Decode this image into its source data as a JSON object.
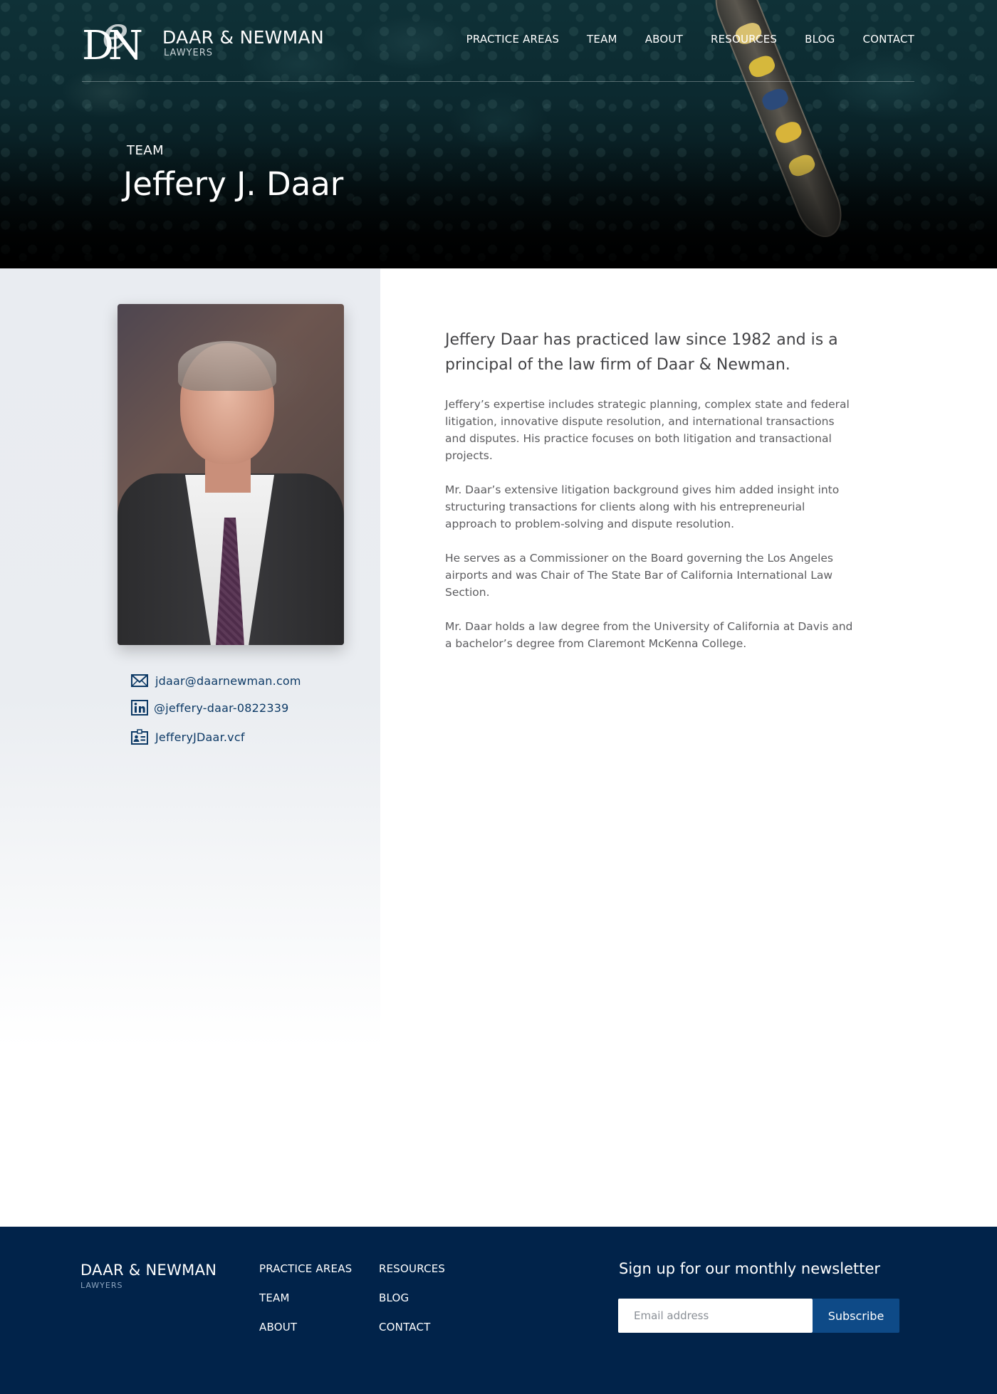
{
  "brand": {
    "name": "DAAR & NEWMAN",
    "sub": "LAWYERS",
    "mark_left": "DN",
    "mark_swash": "e"
  },
  "nav": [
    "PRACTICE AREAS",
    "TEAM",
    "ABOUT",
    "RESOURCES",
    "BLOG",
    "CONTACT"
  ],
  "hero": {
    "label": "TEAM",
    "title": "Jeffery J. Daar"
  },
  "contact": {
    "email": "jdaar@daarnewman.com",
    "linkedin": "@jeffery-daar-0822339",
    "vcard": "JefferyJDaar.vcf"
  },
  "bio": {
    "lead": "Jeffery Daar has practiced law since 1982 and is a principal of the law firm of Daar & Newman.",
    "paragraphs": [
      "Jeffery’s expertise includes strategic planning, complex state and federal litigation, innovative dispute resolution, and international transactions and disputes. His practice focuses on both litigation and transactional projects.",
      "Mr. Daar’s extensive litigation background gives him added insight into structuring transactions for clients along with his entrepreneurial approach to problem-solving and dispute resolution.",
      "He serves as a Commissioner on the Board governing the Los Angeles airports and was Chair of The State Bar of California International Law Section.",
      "Mr. Daar holds a law degree from the University of California at Davis and a bachelor’s degree from Claremont McKenna College."
    ]
  },
  "footer": {
    "brand": "DAAR & NEWMAN",
    "sub": "LAWYERS",
    "links_col1": [
      "PRACTICE AREAS",
      "TEAM",
      "ABOUT"
    ],
    "links_col2": [
      "RESOURCES",
      "BLOG",
      "CONTACT"
    ],
    "newsletter_title": "Sign up for our monthly newsletter",
    "email_placeholder": "Email address",
    "subscribe_label": "Subscribe"
  },
  "colors": {
    "footer_bg": "#01234a",
    "link": "#0d3a66",
    "button": "#0e4a87"
  }
}
